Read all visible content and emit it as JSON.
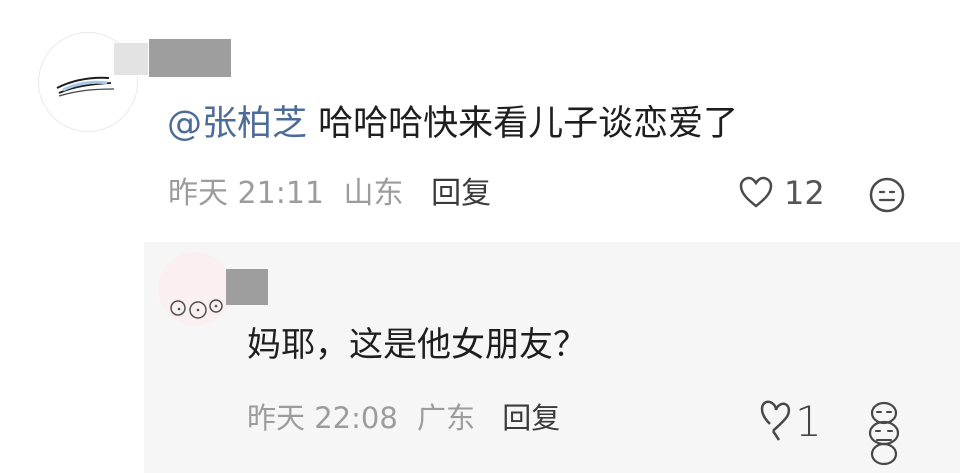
{
  "comments": [
    {
      "mention": "@张柏芝",
      "text": "哈哈哈快来看儿子谈恋爱了",
      "time": "昨天 21:11",
      "location": "山东",
      "reply_label": "回复",
      "likes": "12",
      "like_icon": "heart-outline-icon",
      "emoji_icon": "emoji-face-icon"
    },
    {
      "text": "妈耶，这是他女朋友？",
      "time": "昨天 22:08",
      "location": "广东",
      "reply_label": "回复",
      "likes": "1",
      "like_icon": "heart-outline-icon",
      "emoji_icon": "emoji-face-icon"
    }
  ],
  "colors": {
    "mention": "#4e6c98",
    "meta_text": "#9c9c9c",
    "reply_background": "#f6f6f6"
  }
}
